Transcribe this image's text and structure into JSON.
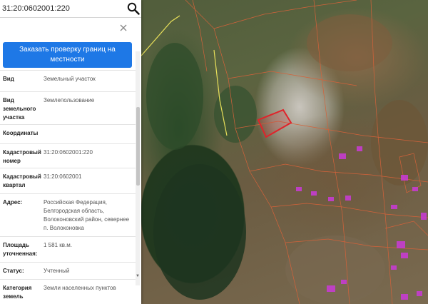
{
  "search": {
    "value": "31:20:0602001:220"
  },
  "info": {
    "order_button_label": "Заказать проверку границ на местности",
    "properties": [
      {
        "label": "Вид",
        "value": "Земельный участок"
      },
      {
        "label": "Вид земельного участка",
        "value": "Землепользование"
      },
      {
        "label": "Координаты",
        "value": ""
      },
      {
        "label": "Кадастровый номер",
        "value": "31:20:0602001:220"
      },
      {
        "label": "Кадастровый квартал",
        "value": "31:20:0602001"
      },
      {
        "label": "Адрес:",
        "value": "Российская Федерация, Белгородская область, Волоконовский район, севернее п. Волоконовка"
      },
      {
        "label": "Площадь уточненная:",
        "value": "1 581 кв.м."
      },
      {
        "label": "Статус:",
        "value": "Учтенный"
      },
      {
        "label": "Категория земель",
        "value": "Земли населенных пунктов"
      }
    ]
  },
  "colors": {
    "accent": "#1e78e6",
    "parcel_highlight": "#e0232a",
    "parcel_border": "#d4623a",
    "building_fill": "#c63cd0",
    "road_line": "#e8e05a"
  },
  "icons": {
    "search": "search-icon",
    "close": "close-icon",
    "scroll_down": "chevron-down-icon"
  }
}
